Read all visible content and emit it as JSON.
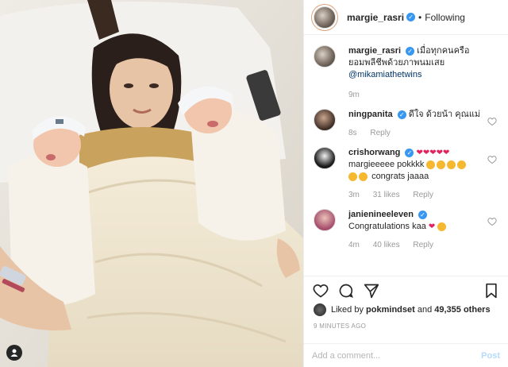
{
  "colors": {
    "accent": "#3897f0",
    "border": "#efefef",
    "muted": "#999999",
    "link": "#003569"
  },
  "header": {
    "username": "margie_rasri",
    "follow_label": "Following",
    "separator": "•"
  },
  "caption": {
    "username": "margie_rasri",
    "text": "เมื่อทุกคนครือยอมพลีชีพด้วยภาพนมเสย",
    "mention": "@mikamiathetwins",
    "time": "9m"
  },
  "comments": [
    {
      "username": "ningpanita",
      "text": "ดีใจ ด้วยน้า คุณแม่",
      "time": "8s",
      "likes": "",
      "reply": "Reply"
    },
    {
      "username": "crishorwang",
      "text": "margieeeee pokkkk",
      "text2": "congrats jaaaa",
      "time": "3m",
      "likes": "31 likes",
      "reply": "Reply"
    },
    {
      "username": "janienineeleven",
      "text": "Congratulations kaa",
      "time": "4m",
      "likes": "40 likes",
      "reply": "Reply"
    }
  ],
  "likes_bar": {
    "prefix": "Liked by",
    "user": "pokmindset",
    "conj": "and",
    "count": "49,355 others"
  },
  "timestamp": "9 MINUTES AGO",
  "add_comment": {
    "placeholder": "Add a comment...",
    "post_label": "Post"
  },
  "icons": [
    "heart-icon",
    "comment-icon",
    "share-icon",
    "bookmark-icon",
    "verified-icon",
    "user-tag-icon"
  ]
}
